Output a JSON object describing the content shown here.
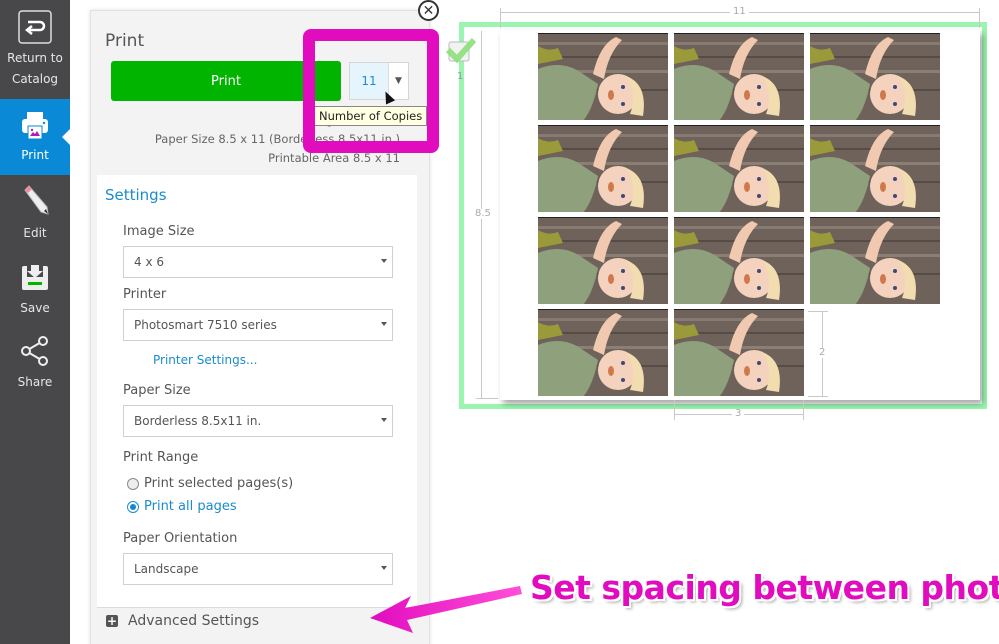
{
  "sidebar": {
    "items": [
      {
        "label_line1": "Return to",
        "label_line2": "Catalog",
        "icon": "return-icon",
        "active": false
      },
      {
        "label": "Print",
        "icon": "printer-icon",
        "active": true
      },
      {
        "label": "Edit",
        "icon": "pencil-icon",
        "active": false
      },
      {
        "label": "Save",
        "icon": "save-icon",
        "active": false
      },
      {
        "label": "Share",
        "icon": "share-icon",
        "active": false
      }
    ],
    "active_color": "#0a8ad6"
  },
  "panel": {
    "title": "Print",
    "close_glyph": "✕",
    "print_button": "Print",
    "copies": {
      "value": "11",
      "dropdown_glyph": "▼",
      "tooltip": "Number of Copies"
    },
    "info": {
      "image_size": "Image Size 4 x 6",
      "paper_size": "Paper Size 8.5 x 11 (Borderless 8.5x11 in.)",
      "printable_area": "Printable Area 8.5 x 11"
    },
    "settings": {
      "title": "Settings",
      "image_size": {
        "label": "Image Size",
        "value": "4 x 6"
      },
      "printer": {
        "label": "Printer",
        "value": "Photosmart 7510 series",
        "link": "Printer Settings..."
      },
      "paper_size": {
        "label": "Paper Size",
        "value": "Borderless 8.5x11 in."
      },
      "print_range": {
        "label": "Print Range",
        "options": [
          {
            "label": "Print selected pages(s)",
            "selected": false
          },
          {
            "label": "Print all pages",
            "selected": true
          }
        ]
      },
      "orientation": {
        "label": "Paper Orientation",
        "value": "Landscape"
      }
    },
    "advanced": {
      "label": "Advanced Settings",
      "glyph": "+"
    }
  },
  "preview": {
    "page_number": "1",
    "page_selected": true,
    "dimensions": {
      "width": "11",
      "height": "8.5",
      "photo_width": "3",
      "photo_height": "2"
    },
    "photo_count": 11,
    "photo_columns": 3
  },
  "annotation": {
    "text": "Set spacing between photos",
    "color": "#e10cbe"
  }
}
